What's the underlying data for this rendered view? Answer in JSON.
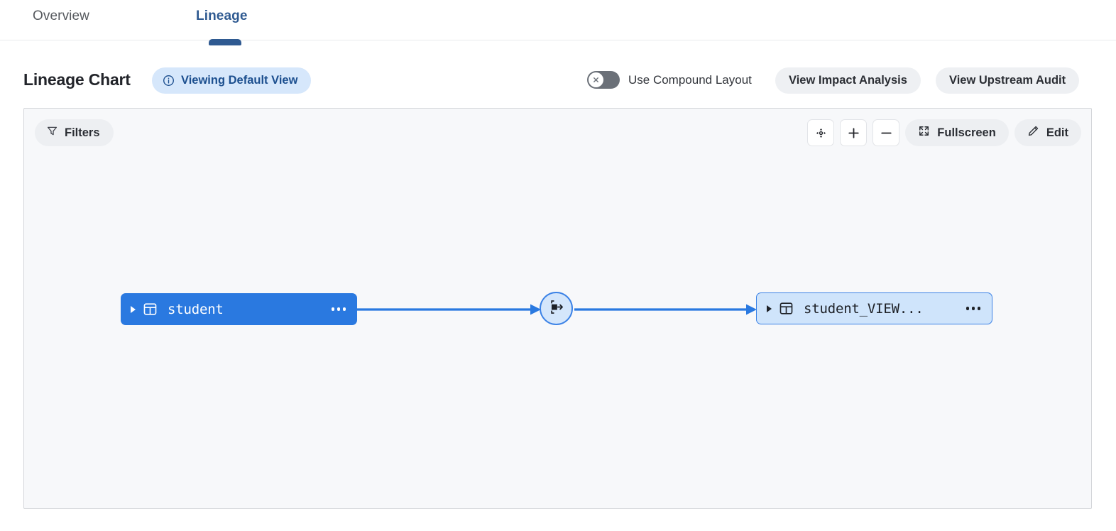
{
  "tabs": [
    {
      "label": "Overview",
      "active": false,
      "name": "tab-overview"
    },
    {
      "label": "Lineage",
      "active": true,
      "name": "tab-lineage"
    }
  ],
  "header": {
    "title": "Lineage Chart",
    "view_badge": {
      "label": "Viewing Default View",
      "icon": "info-circle-icon"
    },
    "compound_layout_toggle": {
      "label": "Use Compound Layout",
      "state": "off",
      "knob_icon": "close-x-icon"
    },
    "buttons": [
      {
        "label": "View Impact Analysis",
        "name": "view-impact-analysis-button"
      },
      {
        "label": "View Upstream Audit",
        "name": "view-upstream-audit-button"
      }
    ]
  },
  "canvas": {
    "filters": {
      "label": "Filters",
      "icon": "funnel-icon"
    },
    "toolbar": [
      {
        "name": "recenter-button",
        "icon": "crosshair-icon",
        "label": ""
      },
      {
        "name": "zoom-in-button",
        "icon": "plus-icon",
        "label": ""
      },
      {
        "name": "zoom-out-button",
        "icon": "minus-icon",
        "label": ""
      },
      {
        "name": "fullscreen-button",
        "icon": "expand-icon",
        "label": "Fullscreen"
      },
      {
        "name": "edit-button",
        "icon": "pencil-icon",
        "label": "Edit"
      }
    ]
  },
  "graph": {
    "nodes": [
      {
        "id": "student",
        "label": "student",
        "type": "table",
        "style": "selected",
        "expand_icon": "chevron-right-icon",
        "type_icon": "table-icon",
        "menu_icon": "more-horizontal-icon"
      },
      {
        "id": "job",
        "label": "",
        "type": "transformation",
        "style": "outlined",
        "type_icon": "transform-job-icon"
      },
      {
        "id": "student_view",
        "label": "student_VIEW...",
        "type": "table",
        "style": "highlighted",
        "expand_icon": "chevron-right-icon",
        "type_icon": "table-icon",
        "menu_icon": "more-horizontal-icon"
      }
    ],
    "edges": [
      {
        "from": "student",
        "to": "job"
      },
      {
        "from": "job",
        "to": "student_view"
      }
    ]
  },
  "colors": {
    "accent_blue": "#2a79e0",
    "tab_active": "#2f5a91",
    "badge_bg": "#d6e7fb",
    "badge_text": "#1c4f8f",
    "pill_bg": "#eef0f3",
    "canvas_bg": "#f7f8fa",
    "node_selected_bg": "#2a79e0",
    "node_highlight_bg": "#cfe4fb",
    "edge": "#2a79e0"
  }
}
